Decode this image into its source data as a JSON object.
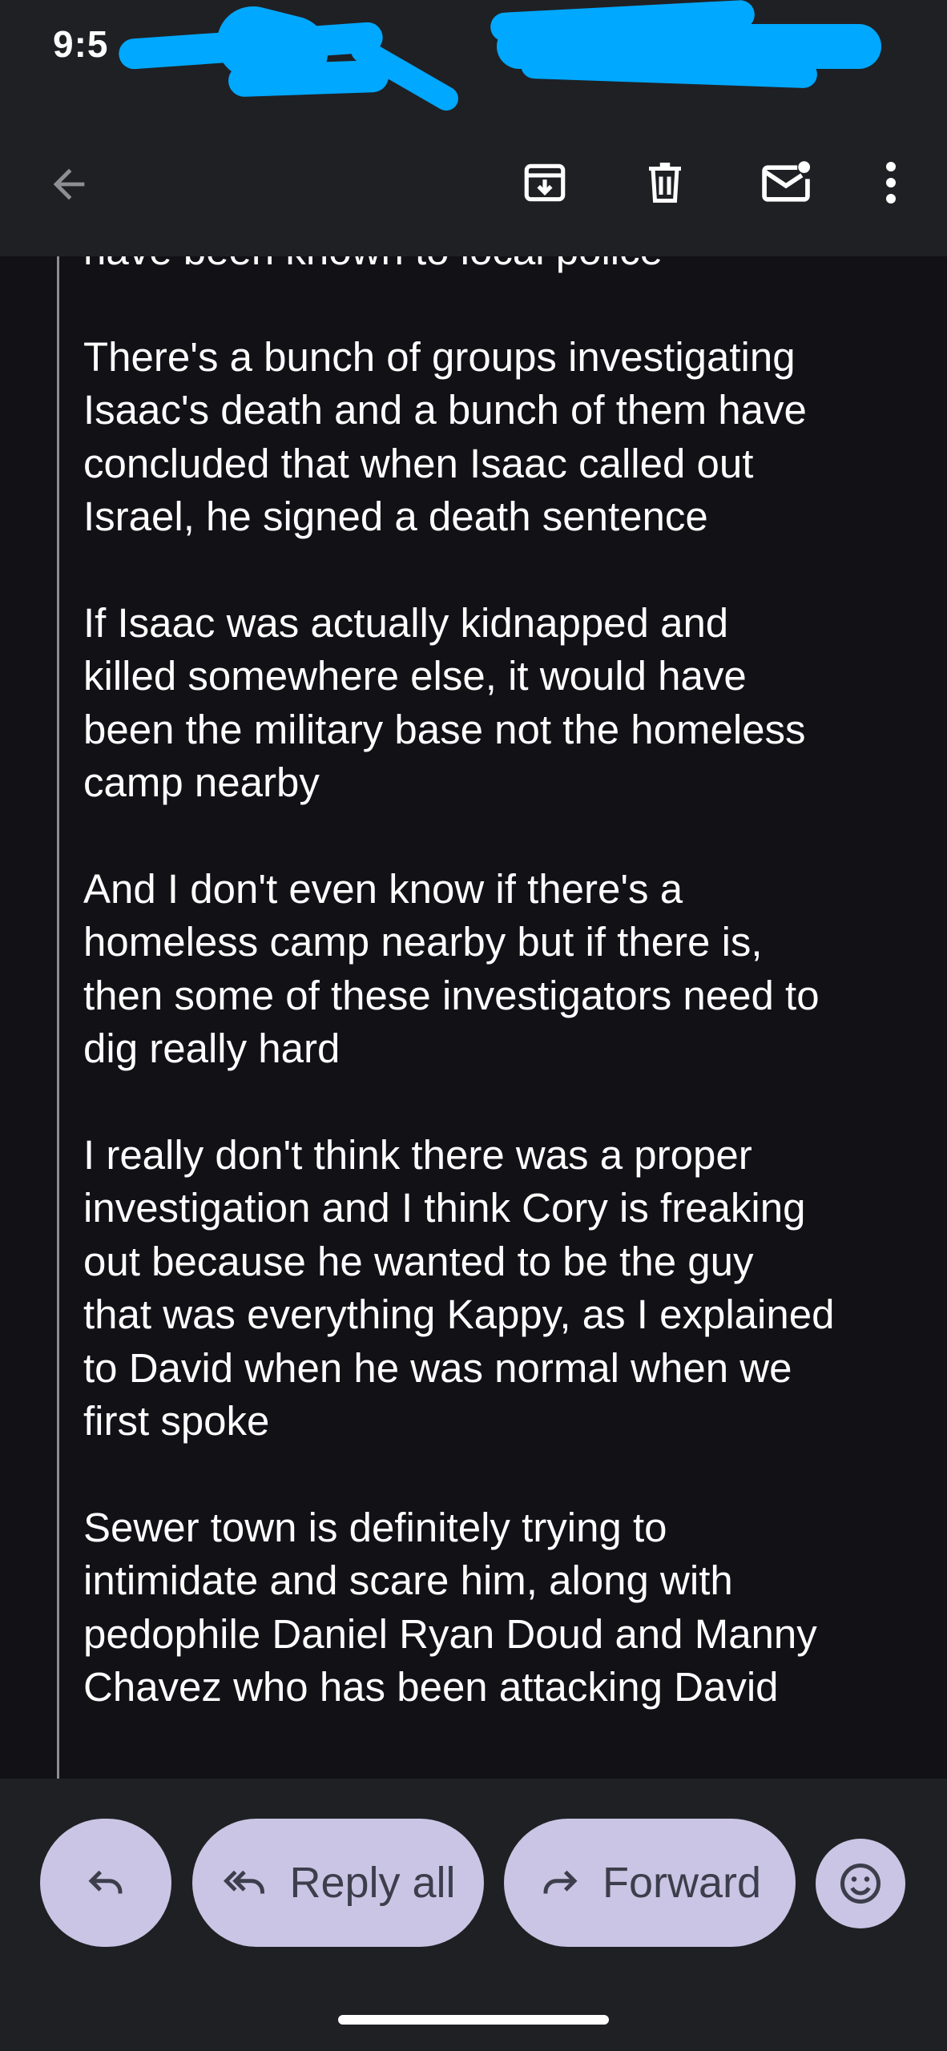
{
  "status_bar": {
    "time": "9:5"
  },
  "email": {
    "partial_top_line": "have been known to local police",
    "paragraphs": [
      "There's a bunch of groups investigating\nIsaac's death and a bunch of them have\nconcluded that when Isaac called out\nIsrael, he signed a death sentence",
      "If Isaac was actually kidnapped and\nkilled somewhere else, it would have\nbeen the military base not the homeless\ncamp nearby",
      "And I don't even know if there's a\nhomeless camp nearby but if there is,\nthen some of these investigators need to\ndig really hard",
      "I really don't think there was a proper\ninvestigation and I think Cory is freaking\nout because he wanted to be the guy\nthat was everything Kappy, as I explained\nto David when he was normal when we\nfirst spoke",
      "Sewer town is definitely trying to\nintimidate and scare him, along with\npedophile Daniel Ryan Doud and Manny\nChavez who has been attacking David"
    ]
  },
  "actions": {
    "reply_all_label": "Reply all",
    "forward_label": "Forward"
  },
  "icons": {
    "back": "arrow-left-icon",
    "archive": "archive-icon",
    "delete": "trash-icon",
    "mark_unread": "mail-unread-icon",
    "more": "more-vert-icon",
    "reply": "reply-icon",
    "reply_all": "reply-all-icon",
    "forward": "forward-icon",
    "emoji": "emoji-icon"
  },
  "colors": {
    "background": "#111116",
    "toolbar": "#1f2024",
    "pill": "#cac5e4",
    "pill_text": "#3d3e4c",
    "redaction": "#00a8ff"
  }
}
